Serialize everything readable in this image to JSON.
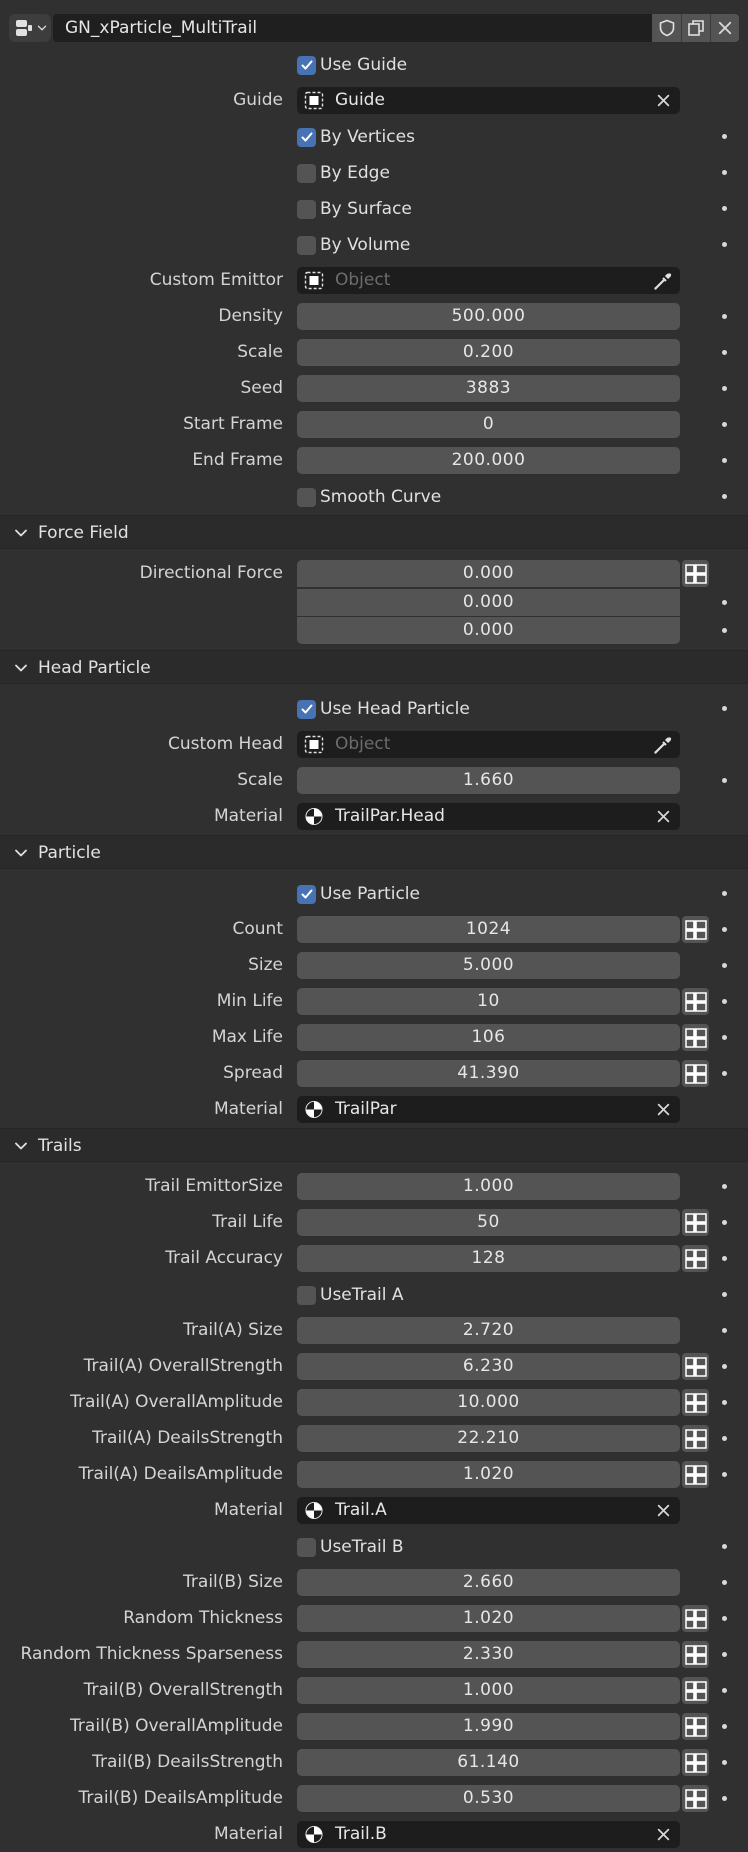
{
  "header": {
    "name": "GN_xParticle_MultiTrail",
    "icon": "geometry-nodes-icon",
    "buttons": [
      "fake-user-shield-icon",
      "duplicate-icon",
      "close-icon"
    ]
  },
  "main": {
    "use_guide": "Use Guide",
    "guide_label": "Guide",
    "guide_value": "Guide",
    "by_vertices": "By Vertices",
    "by_edge": "By Edge",
    "by_surface": "By Surface",
    "by_volume": "By Volume",
    "custom_emitter_label": "Custom Emittor",
    "custom_emitter_placeholder": "Object",
    "density_label": "Density",
    "density": "500.000",
    "scale_label": "Scale",
    "scale": "0.200",
    "seed_label": "Seed",
    "seed": "3883",
    "start_frame_label": "Start Frame",
    "start_frame": "0",
    "end_frame_label": "End Frame",
    "end_frame": "200.000",
    "smooth_curve": "Smooth Curve"
  },
  "force_field": {
    "title": "Force Field",
    "directional_force_label": "Directional Force",
    "x": "0.000",
    "y": "0.000",
    "z": "0.000"
  },
  "head_particle": {
    "title": "Head Particle",
    "use_head_particle": "Use Head Particle",
    "custom_head_label": "Custom Head",
    "custom_head_placeholder": "Object",
    "scale_label": "Scale",
    "scale": "1.660",
    "material_label": "Material",
    "material": "TrailPar.Head"
  },
  "particle": {
    "title": "Particle",
    "use_particle": "Use Particle",
    "count_label": "Count",
    "count": "1024",
    "size_label": "Size",
    "size": "5.000",
    "min_life_label": "Min Life",
    "min_life": "10",
    "max_life_label": "Max Life",
    "max_life": "106",
    "spread_label": "Spread",
    "spread": "41.390",
    "material_label": "Material",
    "material": "TrailPar"
  },
  "trails": {
    "title": "Trails",
    "emittor_size_label": "Trail EmittorSize",
    "emittor_size": "1.000",
    "life_label": "Trail Life",
    "life": "50",
    "accuracy_label": "Trail Accuracy",
    "accuracy": "128",
    "use_trail_a": "UseTrail A",
    "a_size_label": "Trail(A) Size",
    "a_size": "2.720",
    "a_overall_strength_label": "Trail(A) OverallStrength",
    "a_overall_strength": "6.230",
    "a_overall_amplitude_label": "Trail(A) OverallAmplitude",
    "a_overall_amplitude": "10.000",
    "a_details_strength_label": "Trail(A) DeailsStrength",
    "a_details_strength": "22.210",
    "a_details_amplitude_label": "Trail(A) DeailsAmplitude",
    "a_details_amplitude": "1.020",
    "a_material_label": "Material",
    "a_material": "Trail.A",
    "use_trail_b": "UseTrail B",
    "b_size_label": "Trail(B) Size",
    "b_size": "2.660",
    "random_thickness_label": "Random Thickness",
    "random_thickness": "1.020",
    "random_thickness_sparseness_label": "Random Thickness Sparseness",
    "random_thickness_sparseness": "2.330",
    "b_overall_strength_label": "Trail(B) OverallStrength",
    "b_overall_strength": "1.000",
    "b_overall_amplitude_label": "Trail(B) OverallAmplitude",
    "b_overall_amplitude": "1.990",
    "b_details_strength_label": "Trail(B) DeailsStrength",
    "b_details_strength": "61.140",
    "b_details_amplitude_label": "Trail(B) DeailsAmplitude",
    "b_details_amplitude": "0.530",
    "b_material_label": "Material",
    "b_material": "Trail.B"
  },
  "colors": {
    "background": "#303030",
    "field": "#545454",
    "object_field": "#1d1d1d",
    "checkbox_on": "#4772b3",
    "section_header": "#2b2b2b"
  }
}
